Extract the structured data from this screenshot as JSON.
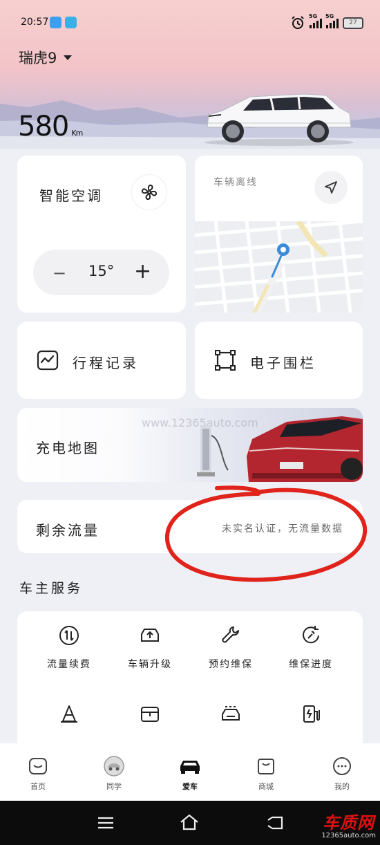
{
  "status_bar": {
    "time": "20:57",
    "battery": "27",
    "network_1": "5G",
    "network_2": "5G"
  },
  "vehicle": {
    "name": "瑞虎9",
    "range_value": "580",
    "range_unit": "Km"
  },
  "climate_card": {
    "title": "智能空调",
    "temperature": "15°",
    "decrease_label": "−",
    "increase_label": "+"
  },
  "location_card": {
    "title": "车辆离线"
  },
  "trip_card": {
    "label": "行程记录"
  },
  "fence_card": {
    "label": "电子围栏"
  },
  "charge_card": {
    "label": "充电地图",
    "watermark": "www.12365auto.com"
  },
  "data_card": {
    "label": "剩余流量",
    "value": "未实名认证，无流量数据"
  },
  "owner_services": {
    "title": "车主服务",
    "items": [
      {
        "label": "流量续费",
        "icon": "data-renew-icon"
      },
      {
        "label": "车辆升级",
        "icon": "car-upgrade-icon"
      },
      {
        "label": "预约维保",
        "icon": "wrench-icon"
      },
      {
        "label": "维保进度",
        "icon": "progress-icon"
      },
      {
        "label": "",
        "icon": "cone-icon"
      },
      {
        "label": "",
        "icon": "seat-icon"
      },
      {
        "label": "",
        "icon": "car-wash-icon"
      },
      {
        "label": "",
        "icon": "charger-icon"
      }
    ]
  },
  "tabbar": {
    "items": [
      {
        "label": "首页",
        "icon": "home-icon"
      },
      {
        "label": "同学",
        "icon": "community-icon"
      },
      {
        "label": "爱车",
        "icon": "car-icon"
      },
      {
        "label": "商城",
        "icon": "shop-icon"
      },
      {
        "label": "我的",
        "icon": "profile-icon"
      }
    ],
    "active": "爱车"
  },
  "watermark_brand": {
    "name": "车质网",
    "url": "12365auto.com"
  },
  "colors": {
    "background": "#eef0f5",
    "card": "#ffffff",
    "annotation": "#e0231b"
  }
}
